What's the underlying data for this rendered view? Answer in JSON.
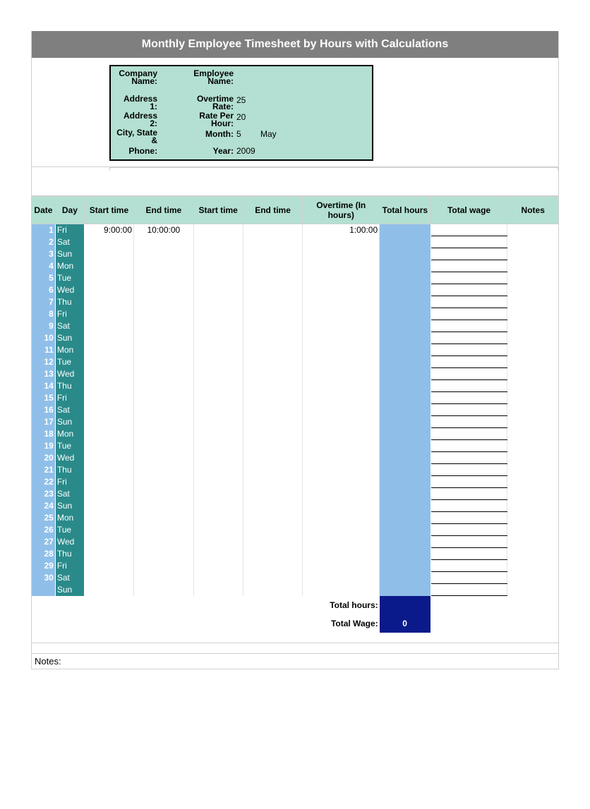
{
  "title": "Monthly Employee Timesheet by Hours with Calculations",
  "info": {
    "company_label": "Company Name:",
    "employee_label": "Employee Name:",
    "address1_label": "Address 1:",
    "overtime_label": "Overtime Rate:",
    "overtime_value": "25",
    "address2_label": "Address 2:",
    "rateper_label": "Rate Per Hour:",
    "rateper_value": "20",
    "city_label": "City, State &",
    "month_label": "Month:",
    "month_value": "5",
    "month_name": "May",
    "phone_label": "Phone:",
    "year_label": "Year:",
    "year_value": "2009"
  },
  "headers": {
    "date": "Date",
    "day": "Day",
    "start1": "Start time",
    "end1": "End time",
    "start2": "Start time",
    "end2": "End time",
    "overtime": "Overtime (In hours)",
    "total_hours": "Total hours",
    "total_wage": "Total wage",
    "notes": "Notes"
  },
  "rows": [
    {
      "date": "1",
      "day": "Fri",
      "start1": "9:00:00",
      "end1": "10:00:00",
      "start2": "",
      "end2": "",
      "ot": "1:00:00",
      "th": "",
      "wage": "",
      "notes": ""
    },
    {
      "date": "2",
      "day": "Sat",
      "start1": "",
      "end1": "",
      "start2": "",
      "end2": "",
      "ot": "",
      "th": "",
      "wage": "",
      "notes": ""
    },
    {
      "date": "3",
      "day": "Sun",
      "start1": "",
      "end1": "",
      "start2": "",
      "end2": "",
      "ot": "",
      "th": "",
      "wage": "",
      "notes": ""
    },
    {
      "date": "4",
      "day": "Mon",
      "start1": "",
      "end1": "",
      "start2": "",
      "end2": "",
      "ot": "",
      "th": "",
      "wage": "",
      "notes": ""
    },
    {
      "date": "5",
      "day": "Tue",
      "start1": "",
      "end1": "",
      "start2": "",
      "end2": "",
      "ot": "",
      "th": "",
      "wage": "",
      "notes": ""
    },
    {
      "date": "6",
      "day": "Wed",
      "start1": "",
      "end1": "",
      "start2": "",
      "end2": "",
      "ot": "",
      "th": "",
      "wage": "",
      "notes": ""
    },
    {
      "date": "7",
      "day": "Thu",
      "start1": "",
      "end1": "",
      "start2": "",
      "end2": "",
      "ot": "",
      "th": "",
      "wage": "",
      "notes": ""
    },
    {
      "date": "8",
      "day": "Fri",
      "start1": "",
      "end1": "",
      "start2": "",
      "end2": "",
      "ot": "",
      "th": "",
      "wage": "",
      "notes": ""
    },
    {
      "date": "9",
      "day": "Sat",
      "start1": "",
      "end1": "",
      "start2": "",
      "end2": "",
      "ot": "",
      "th": "",
      "wage": "",
      "notes": ""
    },
    {
      "date": "10",
      "day": "Sun",
      "start1": "",
      "end1": "",
      "start2": "",
      "end2": "",
      "ot": "",
      "th": "",
      "wage": "",
      "notes": ""
    },
    {
      "date": "11",
      "day": "Mon",
      "start1": "",
      "end1": "",
      "start2": "",
      "end2": "",
      "ot": "",
      "th": "",
      "wage": "",
      "notes": ""
    },
    {
      "date": "12",
      "day": "Tue",
      "start1": "",
      "end1": "",
      "start2": "",
      "end2": "",
      "ot": "",
      "th": "",
      "wage": "",
      "notes": ""
    },
    {
      "date": "13",
      "day": "Wed",
      "start1": "",
      "end1": "",
      "start2": "",
      "end2": "",
      "ot": "",
      "th": "",
      "wage": "",
      "notes": ""
    },
    {
      "date": "14",
      "day": "Thu",
      "start1": "",
      "end1": "",
      "start2": "",
      "end2": "",
      "ot": "",
      "th": "",
      "wage": "",
      "notes": ""
    },
    {
      "date": "15",
      "day": "Fri",
      "start1": "",
      "end1": "",
      "start2": "",
      "end2": "",
      "ot": "",
      "th": "",
      "wage": "",
      "notes": ""
    },
    {
      "date": "16",
      "day": "Sat",
      "start1": "",
      "end1": "",
      "start2": "",
      "end2": "",
      "ot": "",
      "th": "",
      "wage": "",
      "notes": ""
    },
    {
      "date": "17",
      "day": "Sun",
      "start1": "",
      "end1": "",
      "start2": "",
      "end2": "",
      "ot": "",
      "th": "",
      "wage": "",
      "notes": ""
    },
    {
      "date": "18",
      "day": "Mon",
      "start1": "",
      "end1": "",
      "start2": "",
      "end2": "",
      "ot": "",
      "th": "",
      "wage": "",
      "notes": ""
    },
    {
      "date": "19",
      "day": "Tue",
      "start1": "",
      "end1": "",
      "start2": "",
      "end2": "",
      "ot": "",
      "th": "",
      "wage": "",
      "notes": ""
    },
    {
      "date": "20",
      "day": "Wed",
      "start1": "",
      "end1": "",
      "start2": "",
      "end2": "",
      "ot": "",
      "th": "",
      "wage": "",
      "notes": ""
    },
    {
      "date": "21",
      "day": "Thu",
      "start1": "",
      "end1": "",
      "start2": "",
      "end2": "",
      "ot": "",
      "th": "",
      "wage": "",
      "notes": ""
    },
    {
      "date": "22",
      "day": "Fri",
      "start1": "",
      "end1": "",
      "start2": "",
      "end2": "",
      "ot": "",
      "th": "",
      "wage": "",
      "notes": ""
    },
    {
      "date": "23",
      "day": "Sat",
      "start1": "",
      "end1": "",
      "start2": "",
      "end2": "",
      "ot": "",
      "th": "",
      "wage": "",
      "notes": ""
    },
    {
      "date": "24",
      "day": "Sun",
      "start1": "",
      "end1": "",
      "start2": "",
      "end2": "",
      "ot": "",
      "th": "",
      "wage": "",
      "notes": ""
    },
    {
      "date": "25",
      "day": "Mon",
      "start1": "",
      "end1": "",
      "start2": "",
      "end2": "",
      "ot": "",
      "th": "",
      "wage": "",
      "notes": ""
    },
    {
      "date": "26",
      "day": "Tue",
      "start1": "",
      "end1": "",
      "start2": "",
      "end2": "",
      "ot": "",
      "th": "",
      "wage": "",
      "notes": ""
    },
    {
      "date": "27",
      "day": "Wed",
      "start1": "",
      "end1": "",
      "start2": "",
      "end2": "",
      "ot": "",
      "th": "",
      "wage": "",
      "notes": ""
    },
    {
      "date": "28",
      "day": "Thu",
      "start1": "",
      "end1": "",
      "start2": "",
      "end2": "",
      "ot": "",
      "th": "",
      "wage": "",
      "notes": ""
    },
    {
      "date": "29",
      "day": "Fri",
      "start1": "",
      "end1": "",
      "start2": "",
      "end2": "",
      "ot": "",
      "th": "",
      "wage": "",
      "notes": ""
    },
    {
      "date": "30",
      "day": "Sat",
      "start1": "",
      "end1": "",
      "start2": "",
      "end2": "",
      "ot": "",
      "th": "",
      "wage": "",
      "notes": ""
    },
    {
      "date": "",
      "day": "Sun",
      "start1": "",
      "end1": "",
      "start2": "",
      "end2": "",
      "ot": "",
      "th": "",
      "wage": "",
      "notes": ""
    }
  ],
  "totals": {
    "total_hours_label": "Total hours:",
    "total_hours_value": "",
    "total_wage_label": "Total Wage:",
    "total_wage_value": "0"
  },
  "notes_label": "Notes:"
}
